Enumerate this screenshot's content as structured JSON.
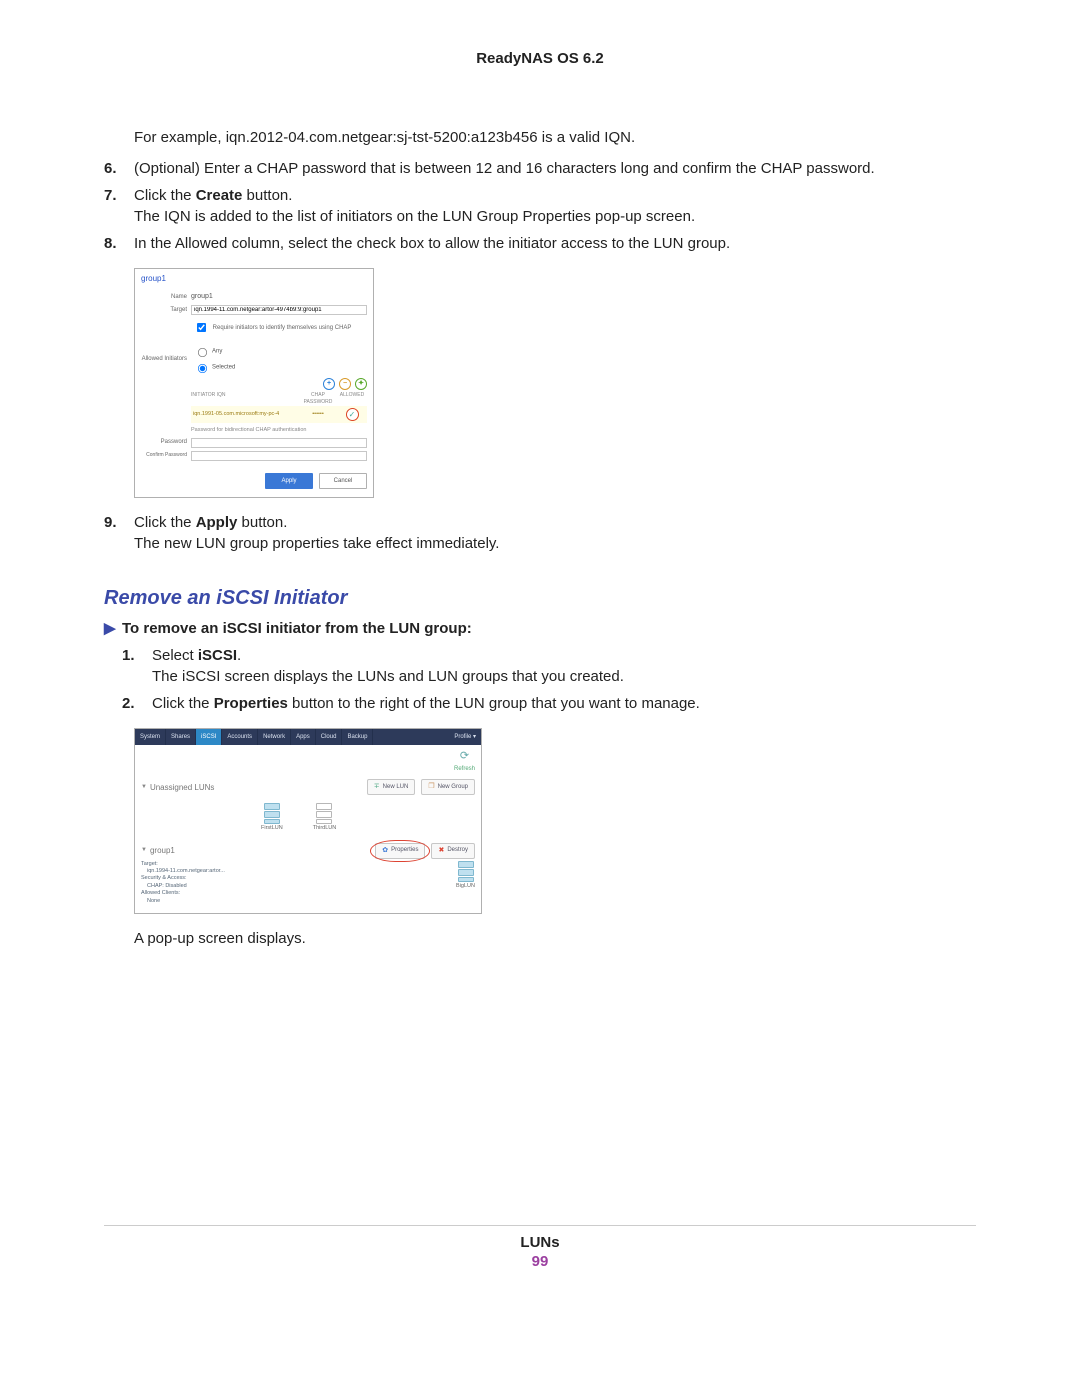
{
  "header": {
    "title": "ReadyNAS OS 6.2"
  },
  "intro_example": "For example, iqn.2012-04.com.netgear:sj-tst-5200:a123b456 is a valid IQN.",
  "steps_a": {
    "s6": {
      "num": "6.",
      "text_a": "(Optional) Enter a CHAP password that is between 12 and 16 characters long and confirm the CHAP password."
    },
    "s7": {
      "num": "7.",
      "line1_a": "Click the ",
      "line1_b": "Create",
      "line1_c": " button.",
      "line2": "The IQN is added to the list of initiators on the LUN Group Properties pop-up screen."
    },
    "s8": {
      "num": "8.",
      "text": "In the Allowed column, select the check box to allow the initiator access to the LUN group."
    },
    "s9": {
      "num": "9.",
      "line1_a": "Click the ",
      "line1_b": "Apply",
      "line1_c": " button.",
      "line2": "The new LUN group properties take effect immediately."
    }
  },
  "ss1": {
    "title": "group1",
    "name_lbl": "Name",
    "name_val": "group1",
    "target_lbl": "Target",
    "target_val": "iqn.1994-11.com.netgear:artor-4974b9:9:group1",
    "chk_label": "Require initiators to identify themselves using CHAP",
    "allowed_lbl": "Allowed Initiators",
    "radio_any": "Any",
    "radio_sel": "Selected",
    "col_iqn": "INITIATOR IQN",
    "col_pwd": "CHAP PASSWORD",
    "col_allowed": "ALLOWED",
    "row_iqn": "iqn.1991-05.com.microsoft:my-pc-4",
    "row_pwd": "••••••",
    "note": "Password for bidirectional CHAP authentication",
    "pwd_lbl": "Password",
    "cpwd_lbl": "Confirm Password",
    "btn_apply": "Apply",
    "btn_cancel": "Cancel"
  },
  "section_heading": "Remove an iSCSI Initiator",
  "sub_intro": "To remove an iSCSI initiator from the LUN group:",
  "steps_b": {
    "s1": {
      "num": "1.",
      "line1_a": "Select ",
      "line1_b": "iSCSI",
      "line1_c": ".",
      "line2": "The iSCSI screen displays the LUNs and LUN groups that you created."
    },
    "s2": {
      "num": "2.",
      "line1_a": "Click the ",
      "line1_b": "Properties",
      "line1_c": " button to the right of the LUN group that you want to manage."
    }
  },
  "ss2": {
    "tabs": {
      "t0": "System",
      "t1": "Shares",
      "t2": "iSCSI",
      "t3": "Accounts",
      "t4": "Network",
      "t5": "Apps",
      "t6": "Cloud",
      "t7": "Backup",
      "t8": "Profile ▾"
    },
    "refresh": "Refresh",
    "unassigned": "Unassigned LUNs",
    "btn_newlun": "New LUN",
    "btn_newgroup": "New Group",
    "lun_first": "FirstLUN",
    "lun_third": "ThirdLUN",
    "group_name": "group1",
    "btn_properties": "Properties",
    "btn_destroy": "Destroy",
    "meta": {
      "target_k": "Target:",
      "target_v": "iqn.1994-11.com.netgear:artor...",
      "sec_k": "Security & Access:",
      "sec_v": "CHAP: Disabled",
      "clients_k": "Allowed Clients:",
      "clients_v": "None"
    },
    "lun_big": "BigLUN"
  },
  "after_ss2": "A pop-up screen displays.",
  "footer": {
    "label": "LUNs",
    "page": "99"
  }
}
